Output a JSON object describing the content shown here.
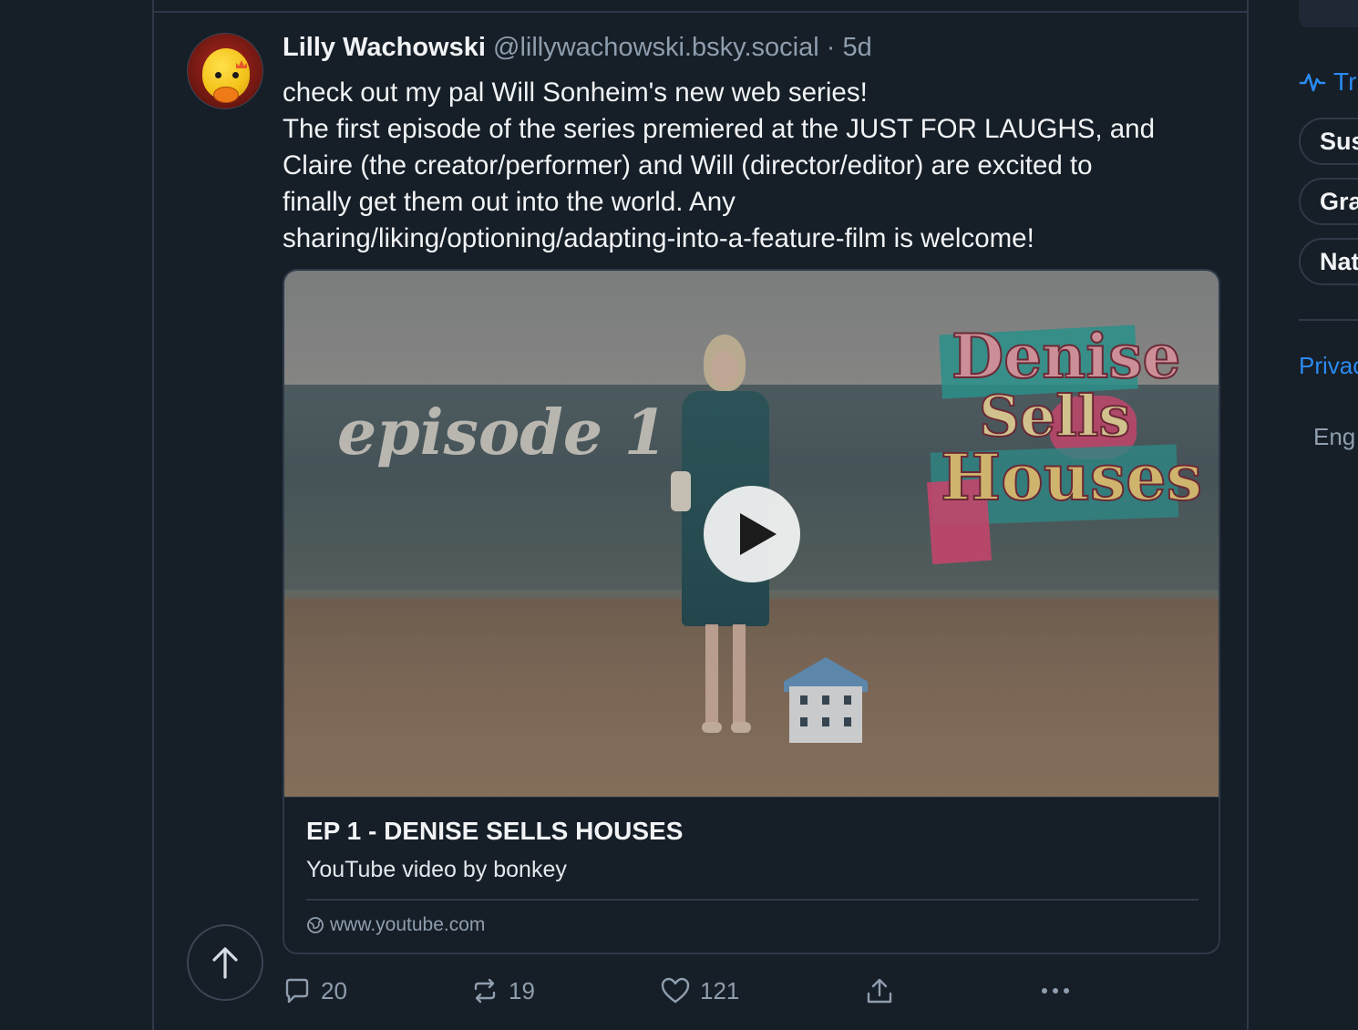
{
  "post": {
    "author": "Lilly Wachowski",
    "handle": "@lillywachowski.bsky.social",
    "separator": "·",
    "age": "5d",
    "text_lines": [
      "check out my pal Will Sonheim's new web series!",
      "The first episode of the series premiered at the JUST FOR LAUGHS, and",
      "Claire (the creator/performer) and Will (director/editor) are excited to",
      "finally get them out into the world. Any",
      "sharing/liking/optioning/adapting-into-a-feature-film is welcome!"
    ]
  },
  "embed": {
    "thumbnail_text": "episode 1",
    "logo_lines": [
      "Denise",
      "Sells",
      "Houses"
    ],
    "title": "EP 1 - DENISE SELLS HOUSES",
    "description": "YouTube video by bonkey",
    "url": "www.youtube.com"
  },
  "actions": {
    "replies": "20",
    "reposts": "19",
    "likes": "121"
  },
  "right_panel": {
    "trending_label": "Tr",
    "pills": [
      "Sus",
      "Gra",
      "Nat"
    ],
    "privacy_link": "Privac",
    "language": "Eng"
  },
  "colors": {
    "background": "#161e27",
    "border": "#2e3a48",
    "muted_text": "#8f9eae",
    "accent": "#2a8bf2"
  }
}
